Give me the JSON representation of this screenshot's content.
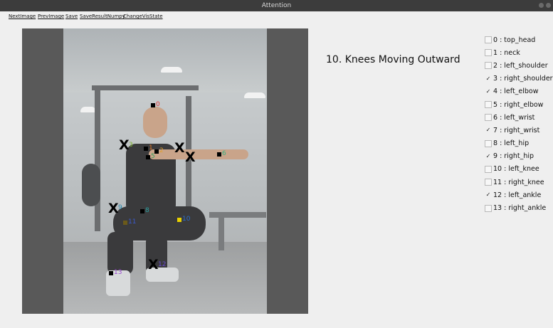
{
  "window": {
    "title": "Attention"
  },
  "menu": [
    {
      "label": "NextImage"
    },
    {
      "label": "PrevImage"
    },
    {
      "label": "Save"
    },
    {
      "label": "SaveResultNumpy"
    },
    {
      "label": "ChangeVisState"
    }
  ],
  "heading": "10. Knees Moving Outward",
  "keypoints": [
    {
      "label": "0",
      "color": "#e03a3a"
    },
    {
      "label": "1",
      "color": "#e07a2a"
    },
    {
      "label": "2",
      "color": "#e0a030"
    },
    {
      "label": "3",
      "color": "#7ab02a"
    },
    {
      "label": "5",
      "color": "#3aa060"
    },
    {
      "label": "6",
      "color": "#3ab080"
    },
    {
      "label": "8",
      "color": "#2aa0a0"
    },
    {
      "label": "9",
      "color": "#2a8ab0"
    },
    {
      "label": "10",
      "color": "#2a70d0"
    },
    {
      "label": "11",
      "color": "#3a5ad0"
    },
    {
      "label": "12",
      "color": "#6a4ad0"
    },
    {
      "label": "13",
      "color": "#9a4ad0"
    }
  ],
  "x_marks": [
    "X",
    "X",
    "X",
    "X",
    "X"
  ],
  "joints": [
    {
      "label": "0 : top_head",
      "checked": false
    },
    {
      "label": "1 : neck",
      "checked": false
    },
    {
      "label": "2 : left_shoulder",
      "checked": false
    },
    {
      "label": "3 : right_shoulder",
      "checked": true
    },
    {
      "label": "4 : left_elbow",
      "checked": true
    },
    {
      "label": "5 : right_elbow",
      "checked": false
    },
    {
      "label": "6 : left_wrist",
      "checked": false
    },
    {
      "label": "7 : right_wrist",
      "checked": true
    },
    {
      "label": "8 : left_hip",
      "checked": false
    },
    {
      "label": "9 : right_hip",
      "checked": true
    },
    {
      "label": "10 : left_knee",
      "checked": false
    },
    {
      "label": "11 : right_knee",
      "checked": false
    },
    {
      "label": "12 : left_ankle",
      "checked": true
    },
    {
      "label": "13 : right_ankle",
      "checked": false
    }
  ],
  "check_glyph": "✓"
}
